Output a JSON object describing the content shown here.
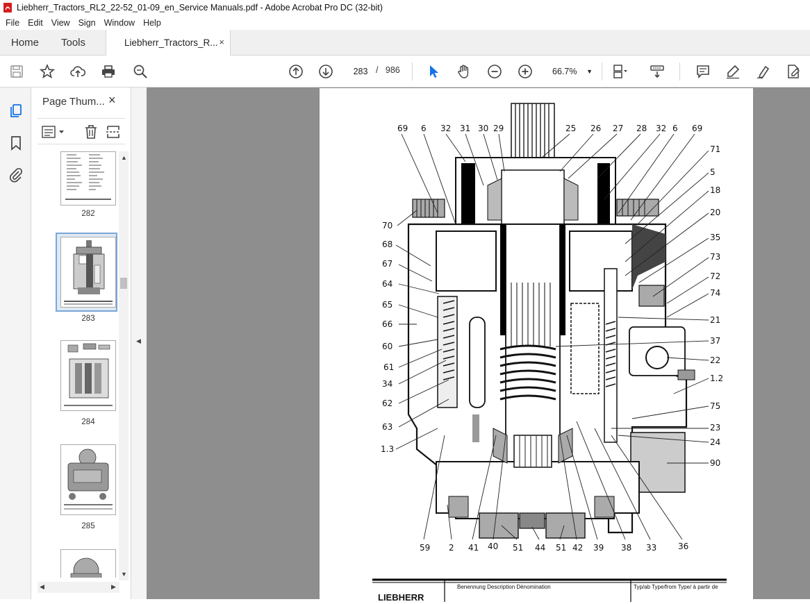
{
  "window": {
    "title": "Liebherr_Tractors_RL2_22-52_01-09_en_Service Manuals.pdf - Adobe Acrobat Pro DC (32-bit)"
  },
  "menu": [
    "File",
    "Edit",
    "View",
    "Sign",
    "Window",
    "Help"
  ],
  "tabs": {
    "home": "Home",
    "tools": "Tools",
    "document": "Liebherr_Tractors_R...",
    "close": "×"
  },
  "toolbar": {
    "current_page": "283",
    "page_separator": "/",
    "total_pages": "986",
    "zoom": "66.7%"
  },
  "panel": {
    "title": "Page Thum...",
    "close": "×",
    "thumbnails": [
      {
        "label": "282"
      },
      {
        "label": "283",
        "selected": true
      },
      {
        "label": "284"
      },
      {
        "label": "285"
      }
    ]
  },
  "drawing": {
    "callouts_top": [
      "69",
      "6",
      "32",
      "31",
      "30",
      "29",
      "25",
      "26",
      "27",
      "28",
      "32",
      "6",
      "69"
    ],
    "callouts_left": [
      "70",
      "68",
      "67",
      "64",
      "65",
      "66",
      "60",
      "61",
      "34",
      "62",
      "63",
      "1.3"
    ],
    "callouts_right": [
      "71",
      "5",
      "18",
      "20",
      "35",
      "73",
      "72",
      "74",
      "21",
      "37",
      "22",
      "1.2",
      "75",
      "23",
      "24",
      "90"
    ],
    "callouts_bottom": [
      "59",
      "2",
      "41",
      "40",
      "51",
      "44",
      "51",
      "42",
      "39",
      "38",
      "33",
      "36"
    ],
    "title_block": {
      "heading": "Benennung  Description  Dénomination",
      "type_heading": "Typ/ab Type/from Type/ à partir de",
      "logo": "LIEBHERR"
    }
  }
}
